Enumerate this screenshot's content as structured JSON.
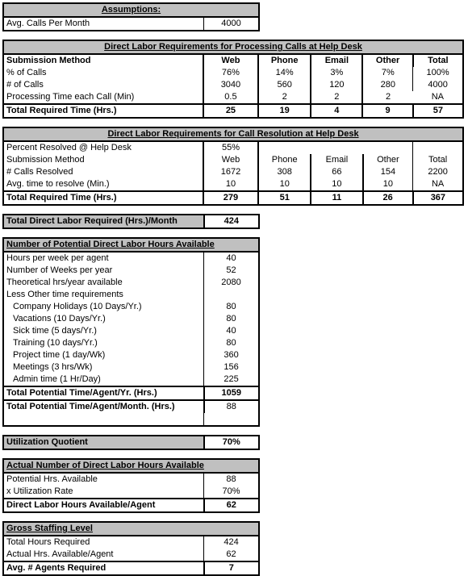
{
  "assumptions": {
    "title": "Assumptions:",
    "rows": [
      {
        "label": "Avg. Calls Per Month",
        "value": "4000"
      }
    ]
  },
  "processing": {
    "title": "Direct Labor Requirements for Processing Calls at Help Desk",
    "columns": [
      "Submission Method",
      "Web",
      "Phone",
      "Email",
      "Other",
      "Total"
    ],
    "rows": [
      {
        "label": "% of Calls",
        "values": [
          "76%",
          "14%",
          "3%",
          "7%",
          "100%"
        ]
      },
      {
        "label": "# of Calls",
        "values": [
          "3040",
          "560",
          "120",
          "280",
          "4000"
        ]
      },
      {
        "label": "Processing Time each Call (Min)",
        "values": [
          "0.5",
          "2",
          "2",
          "2",
          "NA"
        ]
      }
    ],
    "total": {
      "label": "Total Required Time (Hrs.)",
      "values": [
        "25",
        "19",
        "4",
        "9",
        "57"
      ]
    }
  },
  "resolution": {
    "title": "Direct Labor Requirements for Call Resolution at Help Desk",
    "rows": [
      {
        "label": "Percent Resolved @ Help Desk",
        "values": [
          "55%",
          "",
          "",
          "",
          ""
        ]
      },
      {
        "label": "Submission Method",
        "values": [
          "Web",
          "Phone",
          "Email",
          "Other",
          "Total"
        ]
      },
      {
        "label": "# Calls Resolved",
        "values": [
          "1672",
          "308",
          "66",
          "154",
          "2200"
        ]
      },
      {
        "label": "Avg. time to resolve (Min.)",
        "values": [
          "10",
          "10",
          "10",
          "10",
          "NA"
        ]
      }
    ],
    "total": {
      "label": "Total Required Time (Hrs.)",
      "values": [
        "279",
        "51",
        "11",
        "26",
        "367"
      ]
    }
  },
  "total_direct_labor": {
    "label": "Total Direct Labor Required (Hrs.)/Month",
    "value": "424"
  },
  "potential_hours": {
    "title": "Number of Potential Direct Labor Hours Available",
    "rows": [
      {
        "label": "Hours per week per agent",
        "value": "40",
        "indent": false
      },
      {
        "label": "Number of Weeks per year",
        "value": "52",
        "indent": false
      },
      {
        "label": "Theoretical hrs/year available",
        "value": "2080",
        "indent": false
      },
      {
        "label": "Less Other time requirements",
        "value": "",
        "indent": false
      },
      {
        "label": "Company Holidays (10 Days/Yr.)",
        "value": "80",
        "indent": true
      },
      {
        "label": "Vacations (10 Days/Yr.)",
        "value": "80",
        "indent": true
      },
      {
        "label": "Sick time (5 days/Yr.)",
        "value": "40",
        "indent": true
      },
      {
        "label": "Training (10 days/Yr.)",
        "value": "80",
        "indent": true
      },
      {
        "label": "Project time (1 day/Wk)",
        "value": "360",
        "indent": true
      },
      {
        "label": "Meetings (3 hrs/Wk)",
        "value": "156",
        "indent": true
      },
      {
        "label": "Admin time (1 Hr/Day)",
        "value": "225",
        "indent": true
      }
    ],
    "total_year": {
      "label": "Total Potential Time/Agent/Yr. (Hrs.)",
      "value": "1059"
    },
    "total_month": {
      "label": "Total Potential Time/Agent/Month. (Hrs.)",
      "value": "88"
    }
  },
  "utilization": {
    "label": "Utilization Quotient",
    "value": "70%"
  },
  "actual_hours": {
    "title": "Actual Number of Direct Labor Hours Available",
    "rows": [
      {
        "label": "Potential Hrs. Available",
        "value": "88"
      },
      {
        "label": "x Utilization Rate",
        "value": "70%"
      }
    ],
    "total": {
      "label": "Direct Labor Hours Available/Agent",
      "value": "62"
    }
  },
  "staffing": {
    "title": "Gross Staffing Level",
    "rows": [
      {
        "label": "Total Hours Required",
        "value": "424"
      },
      {
        "label": "Actual Hrs. Available/Agent",
        "value": "62"
      }
    ],
    "total": {
      "label": "Avg. # Agents Required",
      "value": "7"
    }
  },
  "colors": {
    "header_fill": "#c0c0c0",
    "border": "#000000",
    "background": "#ffffff"
  }
}
